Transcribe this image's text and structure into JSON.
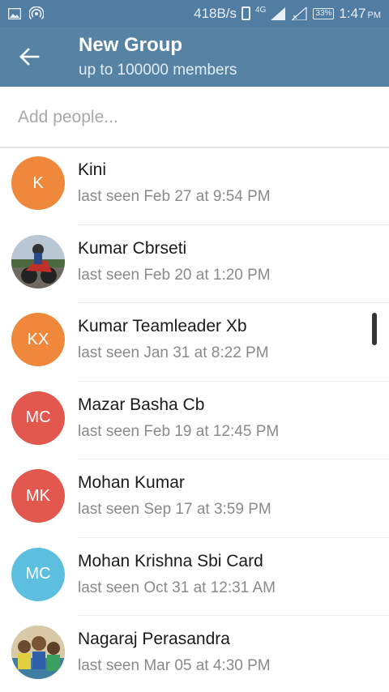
{
  "status_bar": {
    "speed": "418B/s",
    "network": "4G",
    "battery": "33%",
    "time": "1:47",
    "ampm": "PM",
    "icons": [
      "image-icon",
      "hotspot-icon",
      "phone-icon",
      "signal-icon",
      "no-signal-icon",
      "battery-icon"
    ]
  },
  "header": {
    "title": "New Group",
    "subtitle": "up to 100000 members",
    "back_icon": "back-arrow-icon",
    "color": "#5682a3"
  },
  "search": {
    "placeholder": "Add people...",
    "value": ""
  },
  "contacts": [
    {
      "initials": "K",
      "name": "Kini",
      "status": "last seen Feb 27 at 9:54 PM",
      "avatar_color": "#f0883b"
    },
    {
      "initials": "",
      "name": "Kumar Cbrseti",
      "status": "last seen Feb 20 at 1:20 PM",
      "avatar_color": "#7a8aa0",
      "avatar_photo": "motorcycle-photo"
    },
    {
      "initials": "KX",
      "name": "Kumar Teamleader Xb",
      "status": "last seen Jan 31 at 8:22 PM",
      "avatar_color": "#f0883b"
    },
    {
      "initials": "MC",
      "name": "Mazar Basha Cb",
      "status": "last seen Feb 19 at 12:45 PM",
      "avatar_color": "#e2584f"
    },
    {
      "initials": "MK",
      "name": "Mohan Kumar",
      "status": "last seen Sep 17 at 3:59 PM",
      "avatar_color": "#e2584f"
    },
    {
      "initials": "MC",
      "name": "Mohan Krishna Sbi Card",
      "status": "last seen Oct 31 at 12:31 AM",
      "avatar_color": "#5cbfe0"
    },
    {
      "initials": "",
      "name": "Nagaraj Perasandra",
      "status": "last seen Mar 05 at 4:30 PM",
      "avatar_color": "#6a9a5a",
      "avatar_photo": "group-photo"
    }
  ]
}
